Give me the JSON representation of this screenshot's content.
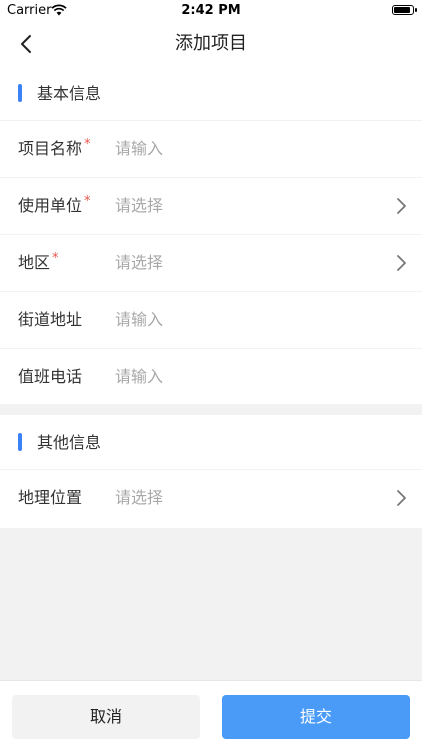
{
  "status_bar": {
    "carrier": "Carrier",
    "time": "2:42 PM"
  },
  "nav": {
    "title": "添加项目"
  },
  "sections": {
    "basic": {
      "title": "基本信息",
      "fields": {
        "project_name": {
          "label": "项目名称",
          "required": "*",
          "placeholder": "请输入"
        },
        "unit": {
          "label": "使用单位",
          "required": "*",
          "placeholder": "请选择"
        },
        "region": {
          "label": "地区",
          "required": "*",
          "placeholder": "请选择"
        },
        "street": {
          "label": "街道地址",
          "placeholder": "请输入"
        },
        "phone": {
          "label": "值班电话",
          "placeholder": "请输入"
        }
      }
    },
    "other": {
      "title": "其他信息",
      "fields": {
        "location": {
          "label": "地理位置",
          "placeholder": "请选择"
        }
      }
    }
  },
  "footer": {
    "cancel_label": "取消",
    "submit_label": "提交"
  },
  "colors": {
    "accent": "#4a9bf7",
    "section_bar": "#3b82f6",
    "required": "#e8544a"
  }
}
